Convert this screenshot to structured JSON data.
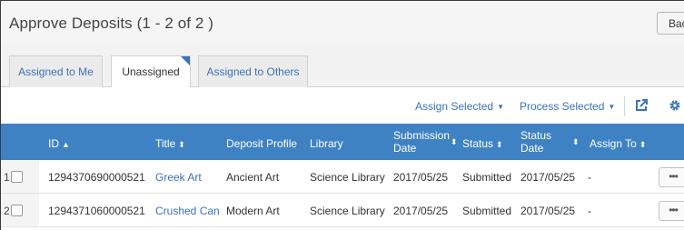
{
  "header": {
    "title": "Approve Deposits (1 - 2 of 2 )",
    "back_label": "Back"
  },
  "tabs": [
    {
      "label": "Assigned to Me",
      "active": false
    },
    {
      "label": "Unassigned",
      "active": true
    },
    {
      "label": "Assigned to Others",
      "active": false
    }
  ],
  "toolbar": {
    "assign_selected": "Assign Selected",
    "process_selected": "Process Selected",
    "export_icon": "export-icon",
    "settings_icon": "gear-icon"
  },
  "table": {
    "columns": {
      "id": "ID",
      "title": "Title",
      "deposit_profile": "Deposit Profile",
      "library": "Library",
      "submission_date_1": "Submission",
      "submission_date_2": "Date",
      "status": "Status",
      "status_date_1": "Status",
      "status_date_2": "Date",
      "assign_to": "Assign To"
    },
    "rows": [
      {
        "num": "1",
        "id": "1294370690000521",
        "title": "Greek Art",
        "deposit_profile": "Ancient Art",
        "library": "Science Library",
        "submission_date": "2017/05/25",
        "status": "Submitted",
        "status_date": "2017/05/25",
        "assign_to": "-",
        "more": "•••"
      },
      {
        "num": "2",
        "id": "1294371060000521",
        "title": "Crushed Can",
        "deposit_profile": "Modern Art",
        "library": "Science Library",
        "submission_date": "2017/05/25",
        "status": "Submitted",
        "status_date": "2017/05/25",
        "assign_to": "-",
        "more": "•••"
      }
    ]
  },
  "colors": {
    "accent": "#3f82c4",
    "link": "#3b73b9",
    "header_bg": "#f5f5f5"
  }
}
